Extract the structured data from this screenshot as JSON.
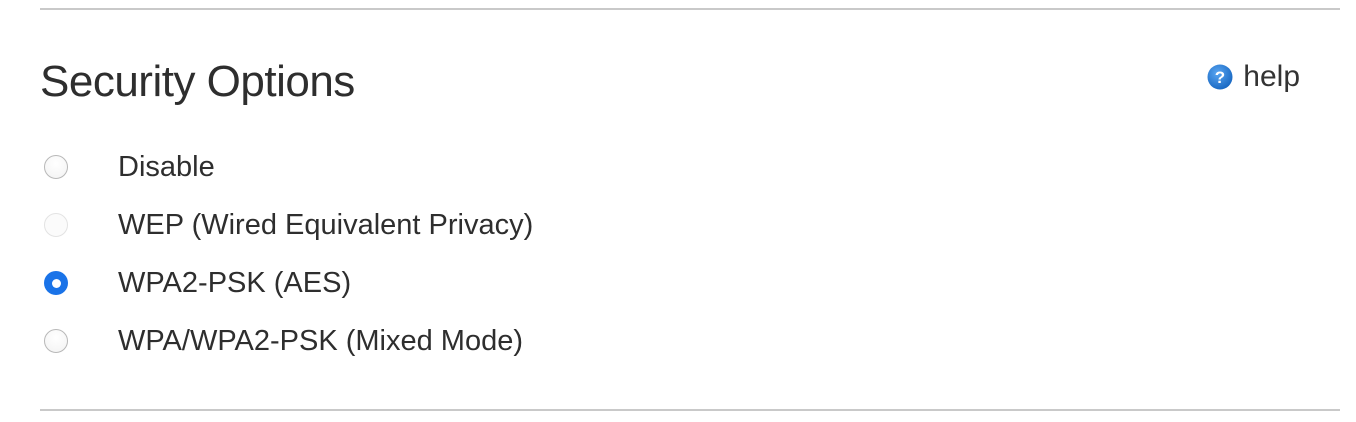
{
  "section": {
    "title": "Security Options",
    "help_label": "help",
    "help_icon": "question-circle-icon",
    "accent_color": "#1a73e8"
  },
  "options": [
    {
      "label": "Disable",
      "selected": false,
      "state": "normal"
    },
    {
      "label": "WEP (Wired Equivalent Privacy)",
      "selected": false,
      "state": "faded"
    },
    {
      "label": "WPA2-PSK (AES)",
      "selected": true,
      "state": "normal"
    },
    {
      "label": "WPA/WPA2-PSK (Mixed Mode)",
      "selected": false,
      "state": "normal"
    }
  ]
}
